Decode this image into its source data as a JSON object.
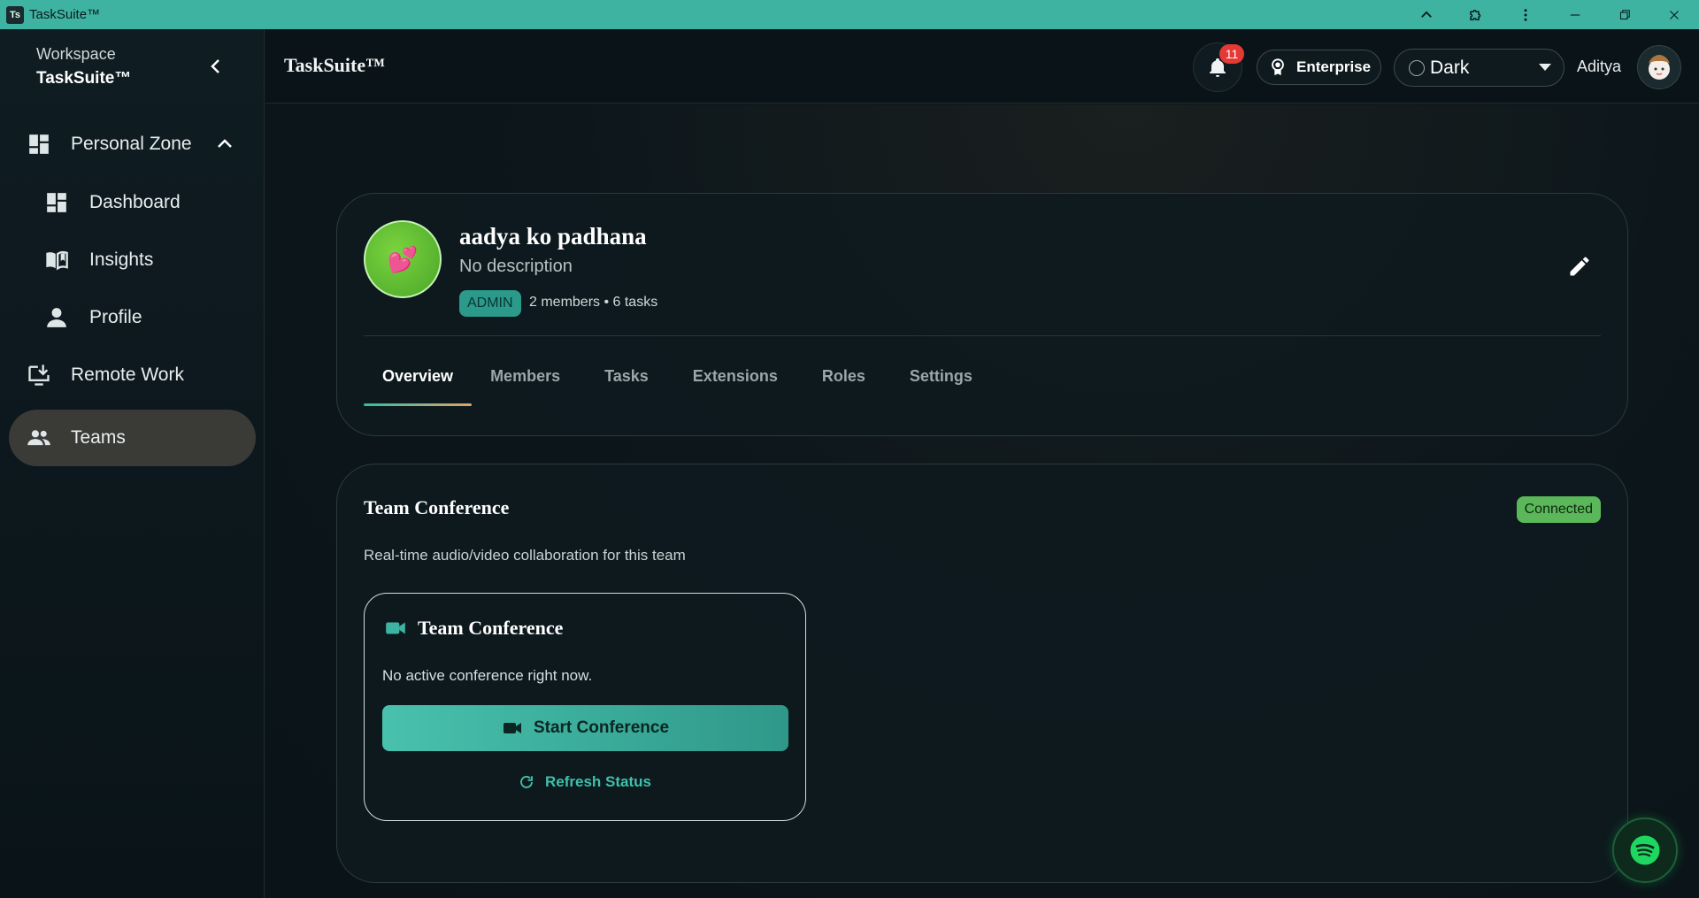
{
  "window": {
    "title": "TaskSuite™",
    "icon_text": "Ts"
  },
  "sidebar": {
    "workspace_label": "Workspace",
    "workspace_name": "TaskSuite™",
    "items": [
      {
        "label": "Personal Zone",
        "icon": "grid-icon",
        "expanded": true
      },
      {
        "label": "Dashboard",
        "icon": "dashboard-icon"
      },
      {
        "label": "Insights",
        "icon": "book-icon"
      },
      {
        "label": "Profile",
        "icon": "person-icon"
      },
      {
        "label": "Remote Work",
        "icon": "monitor-download-icon"
      },
      {
        "label": "Teams",
        "icon": "people-icon",
        "active": true
      }
    ]
  },
  "header": {
    "brand": "TaskSuite™",
    "notification_count": "11",
    "plan_label": "Enterprise",
    "theme_value": "Dark",
    "user_name": "Aditya"
  },
  "team": {
    "name": "aadya ko padhana",
    "description": "No description",
    "role": "ADMIN",
    "meta": "2 members • 6 tasks",
    "avatar_emoji": "💕",
    "tabs": [
      "Overview",
      "Members",
      "Tasks",
      "Extensions",
      "Roles",
      "Settings"
    ],
    "active_tab": "Overview"
  },
  "conference": {
    "title": "Team Conference",
    "status": "Connected",
    "subtitle": "Real-time audio/video collaboration for this team",
    "inner_title": "Team Conference",
    "message": "No active conference right now.",
    "start_label": "Start Conference",
    "refresh_label": "Refresh Status"
  },
  "colors": {
    "accent": "#3fb3a2",
    "badge_red": "#e53935",
    "connected_green": "#5bb85a",
    "spotify_green": "#1ed760"
  }
}
